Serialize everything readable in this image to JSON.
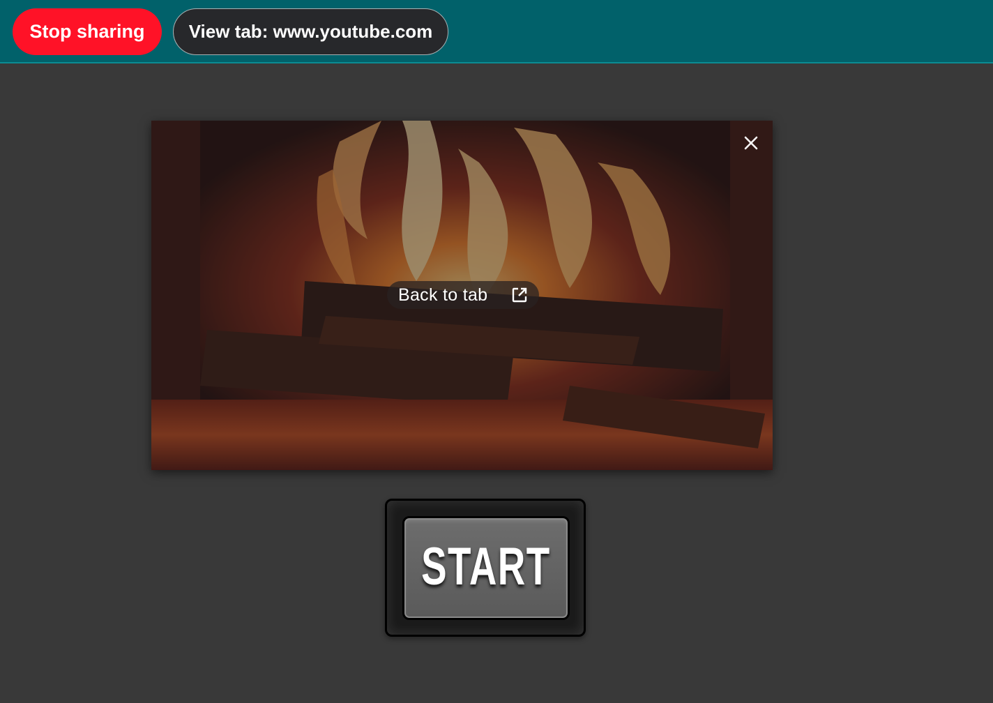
{
  "sharing_bar": {
    "stop_label": "Stop sharing",
    "view_tab_label": "View tab: www.youtube.com",
    "colors": {
      "bar": "#01616a",
      "stop": "#ff1227",
      "view_tab": "#27282b"
    }
  },
  "preview": {
    "back_label": "Back to tab",
    "close_icon": "close-icon",
    "external_icon": "open-in-new-icon"
  },
  "start_button": {
    "label": "START"
  }
}
